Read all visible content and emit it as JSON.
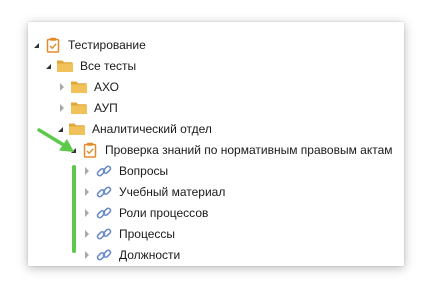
{
  "tree": {
    "root": {
      "label": "Тестирование",
      "icon": "clipboard-check-icon"
    },
    "all_tests": {
      "label": "Все тесты",
      "icon": "folder-open-icon"
    },
    "folders": [
      {
        "label": "АХО",
        "icon": "folder-icon"
      },
      {
        "label": "АУП",
        "icon": "folder-icon"
      },
      {
        "label": "Аналитический отдел",
        "icon": "folder-open-icon"
      }
    ],
    "test": {
      "label": "Проверка знаний по нормативным правовым актам",
      "icon": "clipboard-check-icon"
    },
    "test_items": [
      {
        "label": "Вопросы",
        "icon": "link-icon"
      },
      {
        "label": "Учебный материал",
        "icon": "link-icon"
      },
      {
        "label": "Роли процессов",
        "icon": "link-icon"
      },
      {
        "label": "Процессы",
        "icon": "link-icon"
      },
      {
        "label": "Должности",
        "icon": "link-icon"
      }
    ]
  },
  "annotations": {
    "arrow_color": "#5cc94a",
    "bar_color": "#5cc94a"
  },
  "colors": {
    "folder": "#f2c25a",
    "folder_dark": "#e0a838",
    "clipboard": "#e58a2b",
    "link": "#6a8bc9"
  }
}
